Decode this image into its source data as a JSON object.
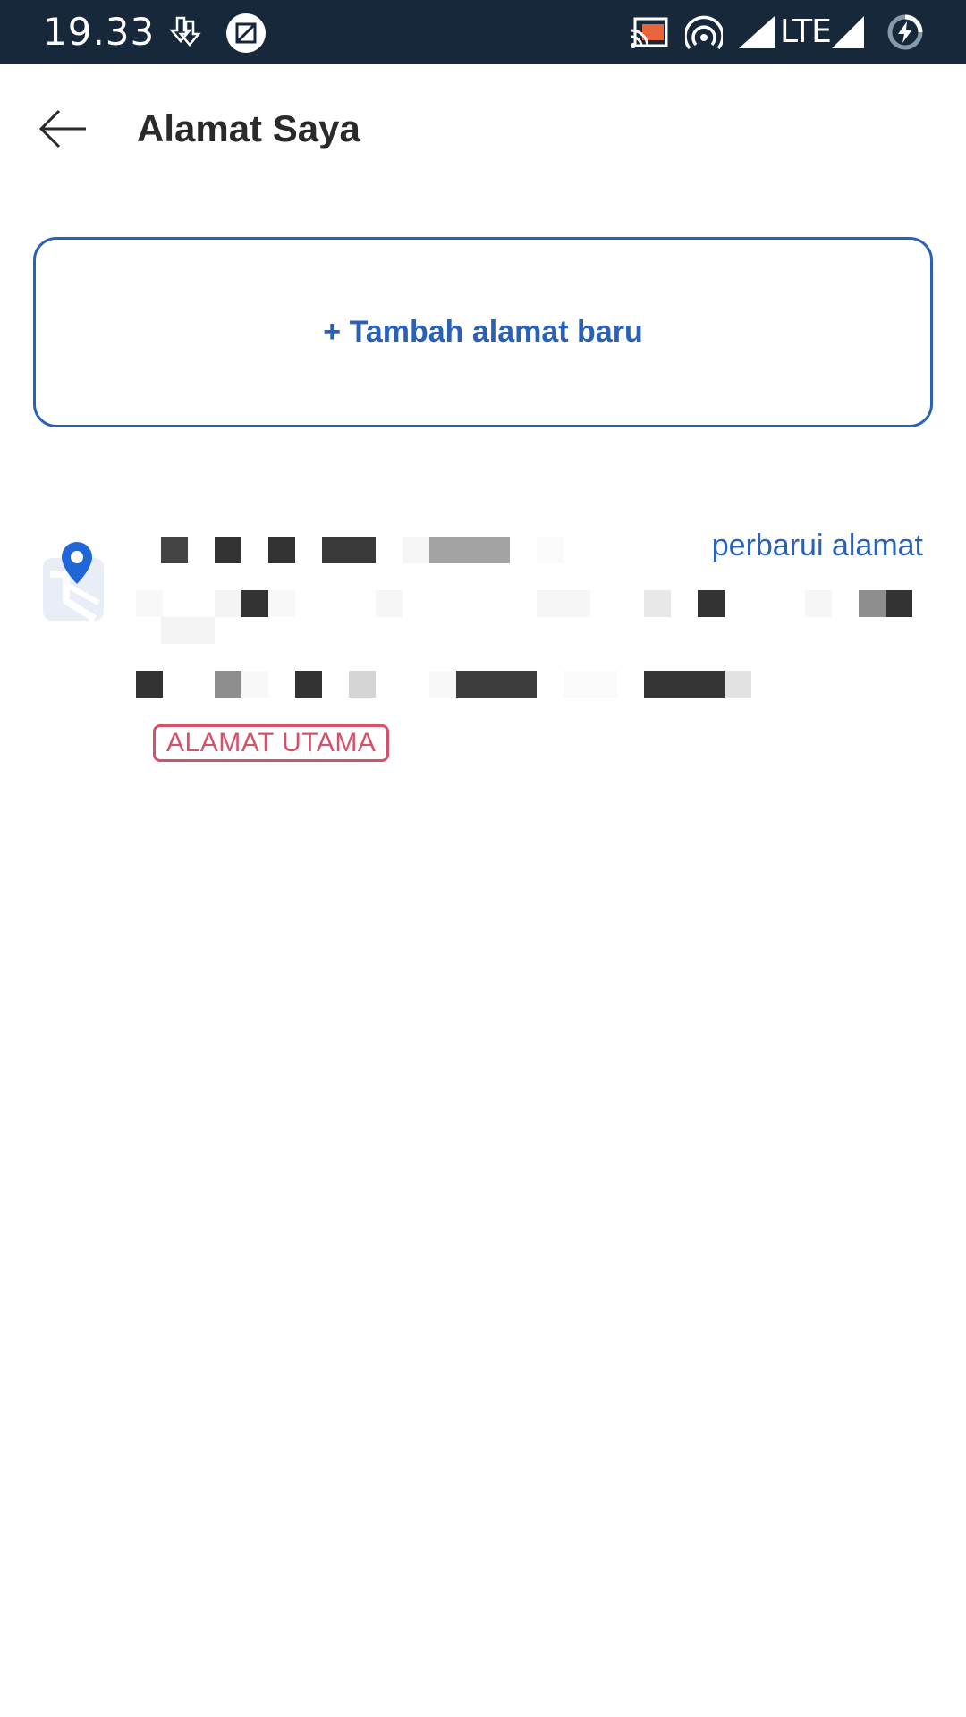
{
  "status_bar": {
    "time": "19.33",
    "network": "LTE",
    "icons": [
      "download-icon",
      "screenshot-icon",
      "cast-icon",
      "hotspot-icon",
      "signal-icon",
      "battery-saver-icon"
    ]
  },
  "app_bar": {
    "back_icon": "arrow-left-icon",
    "title": "Alamat Saya"
  },
  "add_address": {
    "label": "+ Tambah alamat baru"
  },
  "addresses": [
    {
      "icon": "map-pin-icon",
      "update_label": "perbarui alamat",
      "badge": "ALAMAT UTAMA"
    }
  ],
  "colors": {
    "status_bar_bg": "#16283a",
    "accent": "#2a61b8",
    "badge": "#d65068",
    "title_text": "#2a2a2a"
  }
}
